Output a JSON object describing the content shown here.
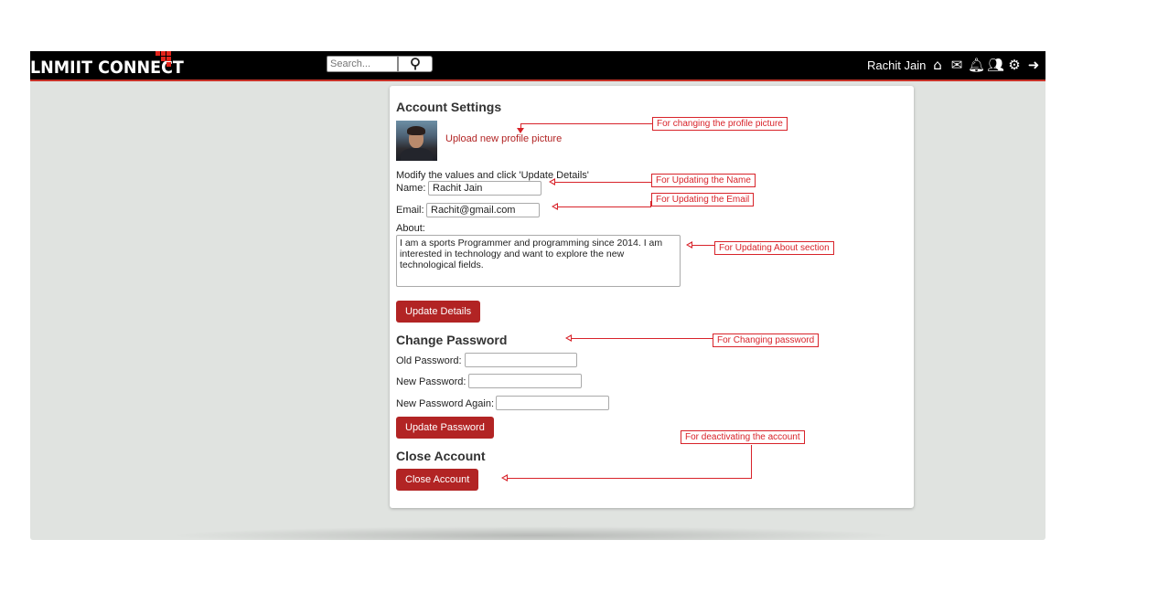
{
  "header": {
    "logo_text": "LNMIIT CONNECT",
    "search_placeholder": "Search...",
    "user_name": "Rachit Jain",
    "icons": [
      "home-icon",
      "envelope-icon",
      "bell-icon",
      "users-icon",
      "gear-icon",
      "sign-out-icon"
    ]
  },
  "account": {
    "title": "Account Settings",
    "upload_label": "Upload new profile picture",
    "instructions": "Modify the values and click 'Update Details'",
    "name_label": "Name:",
    "name_value": "Rachit Jain",
    "email_label": "Email:",
    "email_value": "Rachit@gmail.com",
    "about_label": "About:",
    "about_value": "I am a sports Programmer and programming since 2014. I am interested in technology and want to explore the new technological fields.",
    "update_button": "Update Details"
  },
  "password": {
    "title": "Change Password",
    "old_label": "Old Password:",
    "new_label": "New Password:",
    "again_label": "New Password Again:",
    "update_button": "Update Password"
  },
  "close": {
    "title": "Close Account",
    "button": "Close Account"
  },
  "annotations": {
    "profile_picture": "For changing the profile picture",
    "name": "For Updating the Name",
    "email": "For Updating the Email",
    "about": "For Updating About section",
    "password": "For Changing password",
    "deactivate": "For deactivating the account"
  },
  "colors": {
    "accent": "#b22424",
    "annotation": "#d8232a",
    "header_bg": "#000000",
    "page_bg": "#e0e3e0"
  }
}
